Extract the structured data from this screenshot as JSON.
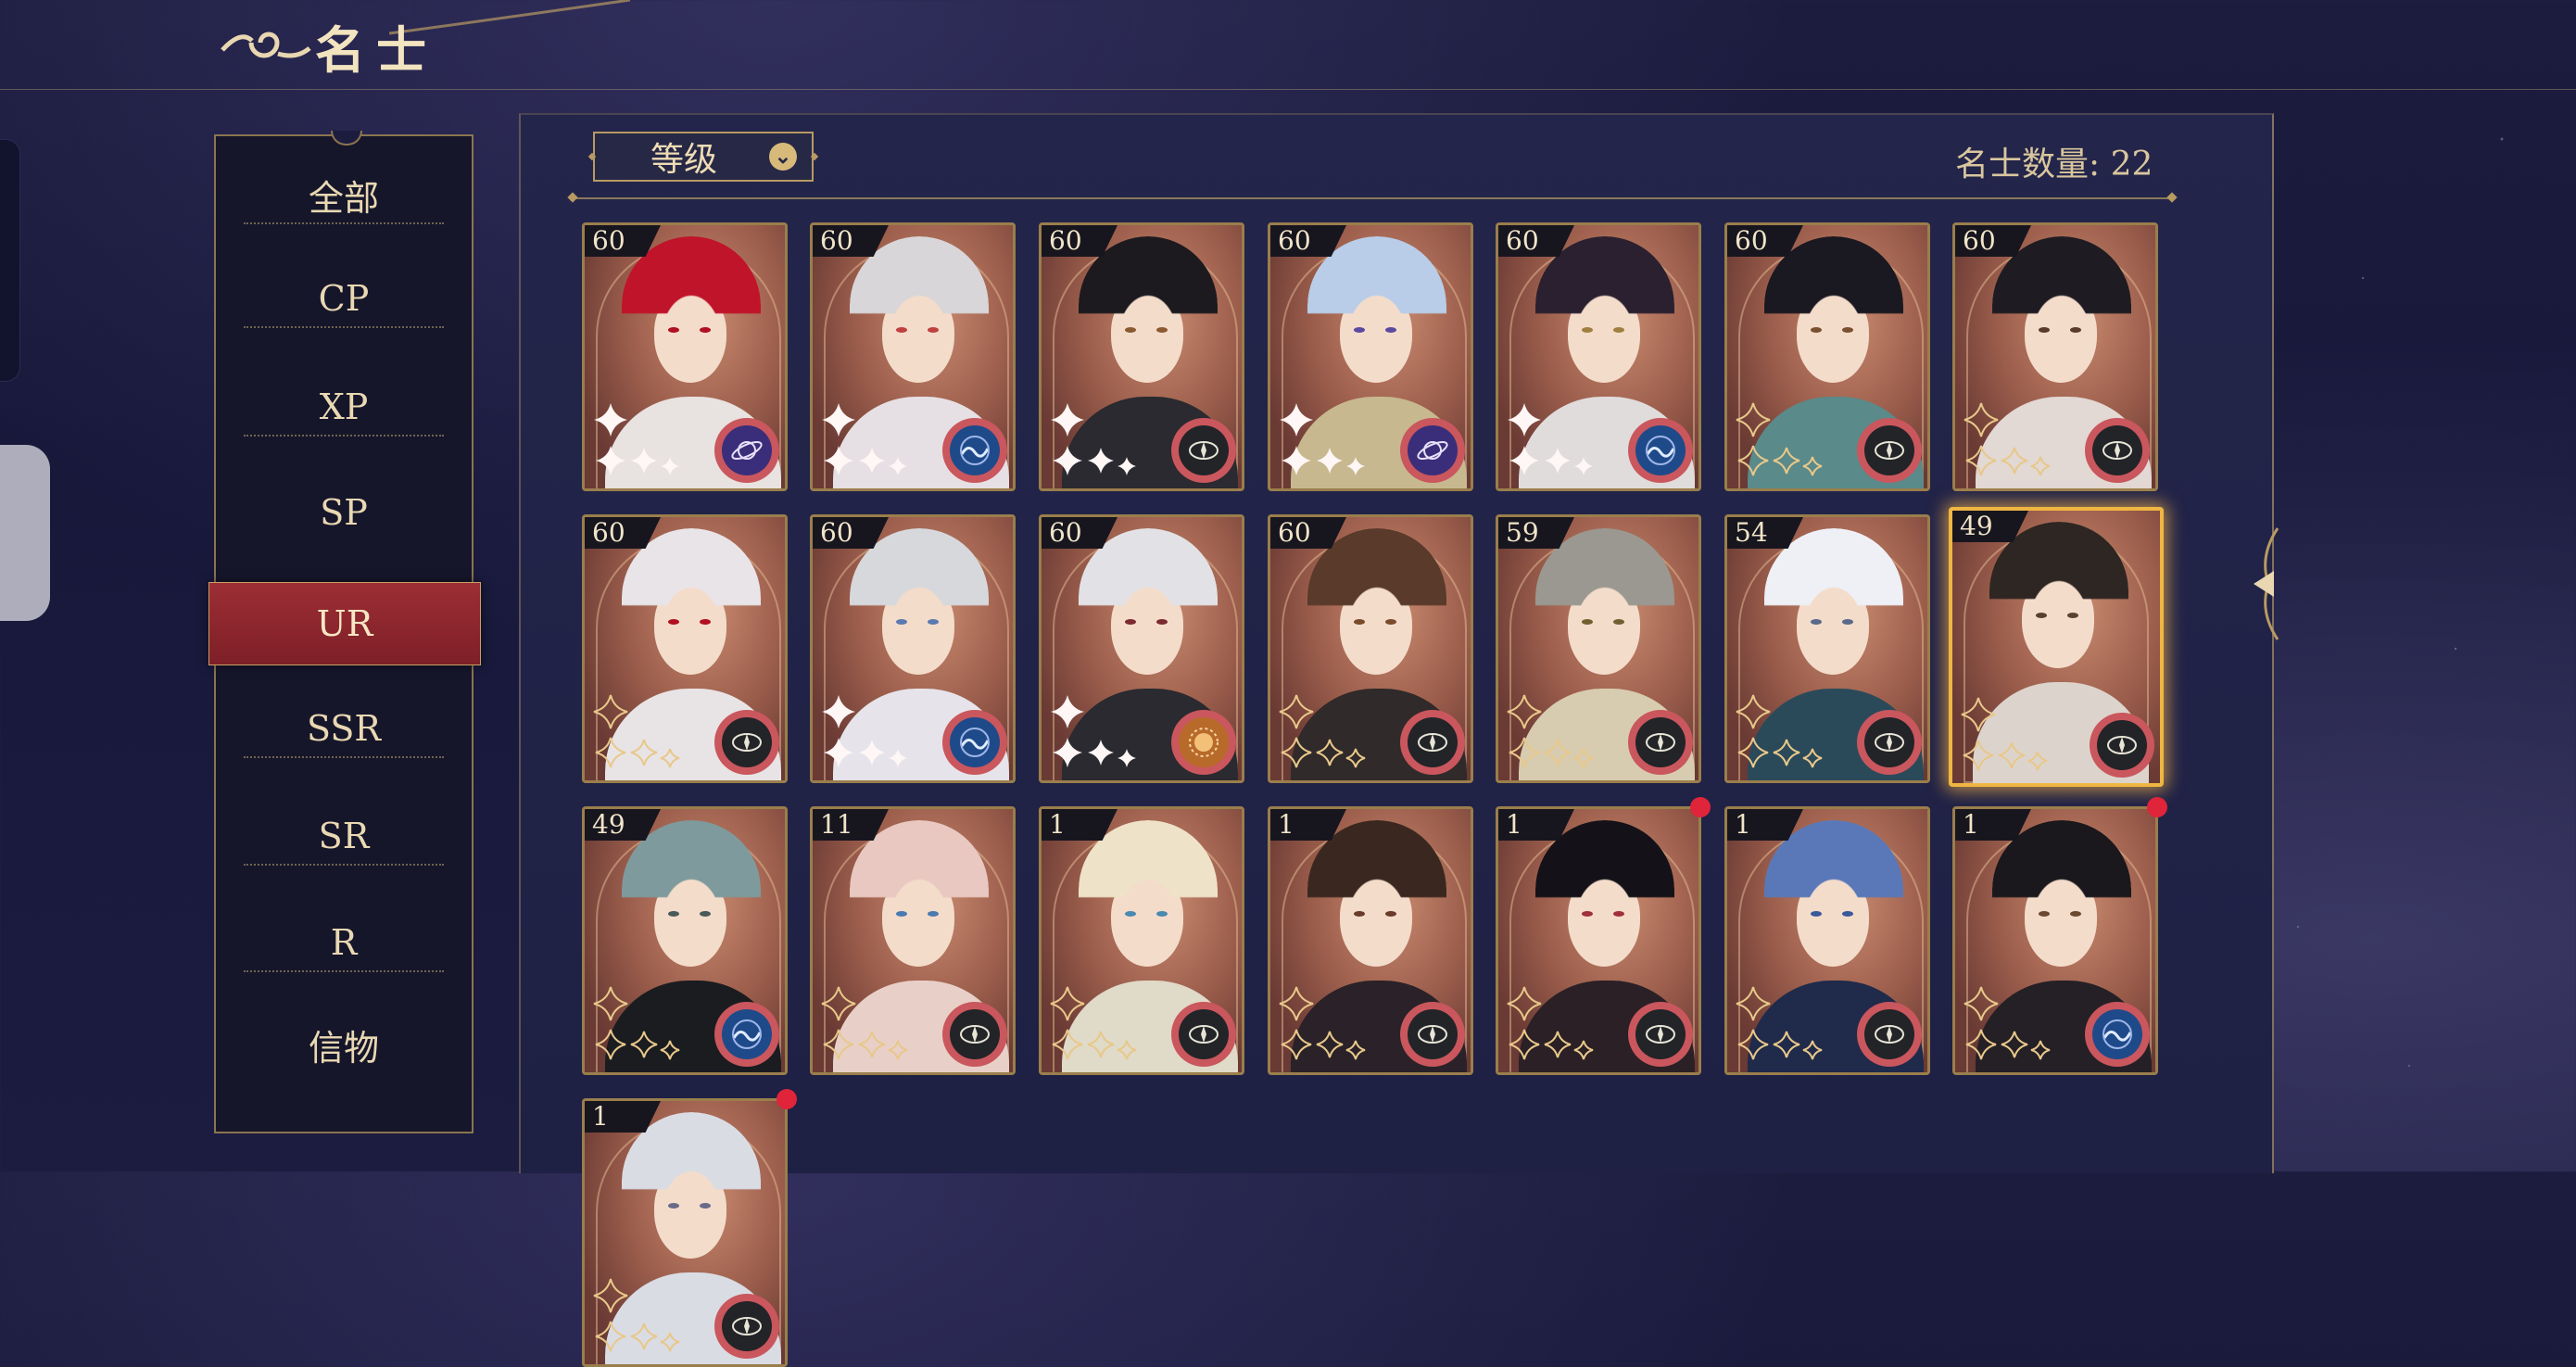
{
  "header": {
    "title": "名士"
  },
  "sidebar": {
    "items": [
      {
        "label": "全部"
      },
      {
        "label": "CP"
      },
      {
        "label": "XP"
      },
      {
        "label": "SP"
      },
      {
        "label": "UR"
      },
      {
        "label": "SSR"
      },
      {
        "label": "SR"
      },
      {
        "label": "R"
      },
      {
        "label": "信物"
      }
    ],
    "active": "UR"
  },
  "filter": {
    "label": "等级"
  },
  "count": {
    "label": "名士数量: 22"
  },
  "cards": [
    {
      "level": "60",
      "hair": "#c0142a",
      "eye": "#b01022",
      "outfit": "#e8e2e0",
      "badge": "planet",
      "sparkles": true
    },
    {
      "level": "60",
      "hair": "#d8d6d8",
      "eye": "#c04040",
      "outfit": "#e6e0e4",
      "badge": "wave",
      "sparkles": true
    },
    {
      "level": "60",
      "hair": "#1c1a1f",
      "eye": "#8a5a30",
      "outfit": "#2a2a30",
      "badge": "compass",
      "sparkles": true
    },
    {
      "level": "60",
      "hair": "#b9cde8",
      "eye": "#5a4aa0",
      "outfit": "#c8b890",
      "badge": "planet",
      "sparkles": true
    },
    {
      "level": "60",
      "hair": "#2a2030",
      "eye": "#a08040",
      "outfit": "#e0dcdc",
      "badge": "wave",
      "sparkles": true
    },
    {
      "level": "60",
      "hair": "#1a1820",
      "eye": "#7a5030",
      "outfit": "#5a8a8a",
      "badge": "compass",
      "sparkles": false
    },
    {
      "level": "60",
      "hair": "#1e1c22",
      "eye": "#5a3a28",
      "outfit": "#e2d8d4",
      "badge": "compass",
      "sparkles": false
    },
    {
      "level": "60",
      "hair": "#e8e4e8",
      "eye": "#b01020",
      "outfit": "#e8e4e6",
      "badge": "compass",
      "sparkles": false
    },
    {
      "level": "60",
      "hair": "#d6d8dc",
      "eye": "#5a7ab0",
      "outfit": "#e6e4ea",
      "badge": "wave",
      "sparkles": true
    },
    {
      "level": "60",
      "hair": "#e2e2e6",
      "eye": "#7a2a30",
      "outfit": "#2a2a30",
      "badge": "sun",
      "sparkles": true
    },
    {
      "level": "60",
      "hair": "#5a3a2a",
      "eye": "#7a4a2a",
      "outfit": "#302a2a",
      "badge": "compass",
      "sparkles": false
    },
    {
      "level": "59",
      "hair": "#9a9890",
      "eye": "#706030",
      "outfit": "#d8ccb0",
      "badge": "compass",
      "sparkles": false
    },
    {
      "level": "54",
      "hair": "#eef0f6",
      "eye": "#5a6a8a",
      "outfit": "#2a4a5a",
      "badge": "compass",
      "sparkles": false
    },
    {
      "level": "49",
      "hair": "#2e2622",
      "eye": "#5a4030",
      "outfit": "#dcd4cc",
      "badge": "compass",
      "sparkles": false,
      "highlight": true
    },
    {
      "level": "49",
      "hair": "#7e9a9c",
      "eye": "#4a5a5a",
      "outfit": "#1a1c20",
      "badge": "wave",
      "sparkles": false
    },
    {
      "level": "11",
      "hair": "#e8c8c0",
      "eye": "#4a7ab0",
      "outfit": "#e8d0c8",
      "badge": "compass",
      "sparkles": false
    },
    {
      "level": "1",
      "hair": "#eee2c8",
      "eye": "#4a8ab0",
      "outfit": "#e0dac8",
      "badge": "compass",
      "sparkles": false
    },
    {
      "level": "1",
      "hair": "#3a2820",
      "eye": "#6a3a2a",
      "outfit": "#2a2228",
      "badge": "compass",
      "sparkles": false
    },
    {
      "level": "1",
      "hair": "#141218",
      "eye": "#a0303a",
      "outfit": "#2a2026",
      "badge": "compass",
      "sparkles": false,
      "dot": true
    },
    {
      "level": "1",
      "hair": "#5a78b8",
      "eye": "#3a5a9a",
      "outfit": "#202a4a",
      "badge": "compass",
      "sparkles": false
    },
    {
      "level": "1",
      "hair": "#1a181c",
      "eye": "#6a4a30",
      "outfit": "#242026",
      "badge": "wave",
      "sparkles": false,
      "dot": true
    },
    {
      "level": "1",
      "hair": "#dadce4",
      "eye": "#6a6a8a",
      "outfit": "#dadce4",
      "badge": "compass",
      "sparkles": false,
      "dot": true
    }
  ],
  "colors": {
    "accent_gold": "#b89a62",
    "active_red": "#8f252d",
    "badge_red": "#c9575d",
    "notify_red": "#e0243a",
    "highlight": "#f0b642"
  }
}
